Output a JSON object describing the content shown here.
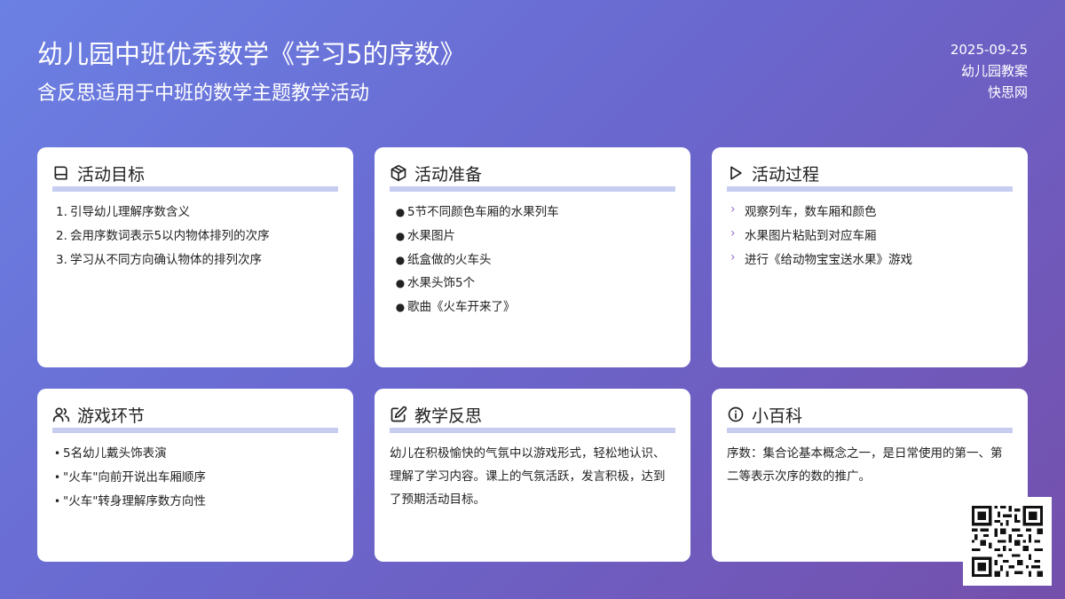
{
  "header": {
    "title": "幼儿园中班优秀数学《学习5的序数》",
    "subtitle": "含反思适用于中班的数学主题教学活动"
  },
  "meta": {
    "date": "2025-09-25",
    "category": "幼儿园教案",
    "source": "快思网"
  },
  "cards": {
    "goals": {
      "icon": "book-icon",
      "title": "活动目标",
      "items": [
        {
          "n": "1.",
          "text": "引导幼儿理解序数含义"
        },
        {
          "n": "2.",
          "text": "会用序数词表示5以内物体排列的次序"
        },
        {
          "n": "3.",
          "text": "学习从不同方向确认物体的排列次序"
        }
      ]
    },
    "prep": {
      "icon": "box-icon",
      "title": "活动准备",
      "items": [
        "5节不同颜色车厢的水果列车",
        "水果图片",
        "纸盒做的火车头",
        "水果头饰5个",
        "歌曲《火车开来了》"
      ]
    },
    "process": {
      "icon": "play-icon",
      "title": "活动过程",
      "items": [
        "观察列车，数车厢和颜色",
        "水果图片粘贴到对应车厢",
        "进行《给动物宝宝送水果》游戏"
      ]
    },
    "game": {
      "icon": "users-icon",
      "title": "游戏环节",
      "items": [
        "5名幼儿戴头饰表演",
        "\"火车\"向前开说出车厢顺序",
        "\"火车\"转身理解序数方向性"
      ]
    },
    "reflection": {
      "icon": "edit-icon",
      "title": "教学反思",
      "text": "幼儿在积极愉快的气氛中以游戏形式，轻松地认识、理解了学习内容。课上的气氛活跃，发言积极，达到了预期活动目标。"
    },
    "wiki": {
      "icon": "info-icon",
      "title": "小百科",
      "text": "序数：集合论基本概念之一，是日常使用的第一、第二等表示次序的数的推广。"
    }
  },
  "colors": {
    "accent_bar": "#c6cdf0",
    "chevron": "#9b6fc8",
    "bg_start": "#6b80e3",
    "bg_end": "#744fac"
  }
}
